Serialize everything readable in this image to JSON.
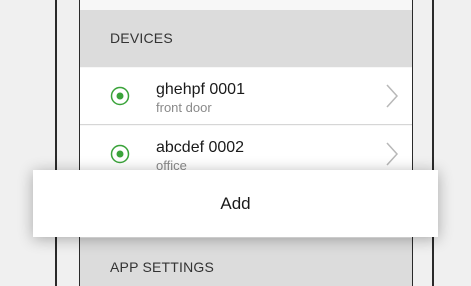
{
  "sections": {
    "devices_label": "DEVICES",
    "app_settings_label": "APP SETTINGS"
  },
  "devices": [
    {
      "name": "ghehpf 0001",
      "location": "front door",
      "status_icon": "radio-on-icon",
      "status_color": "#3aa33a"
    },
    {
      "name": "abcdef 0002",
      "location": "office",
      "status_icon": "radio-on-icon",
      "status_color": "#3aa33a"
    }
  ],
  "popup": {
    "add_label": "Add"
  },
  "colors": {
    "accent_green": "#3aa33a",
    "header_bg": "#dcdcdc",
    "background": "#f0f0f0"
  }
}
